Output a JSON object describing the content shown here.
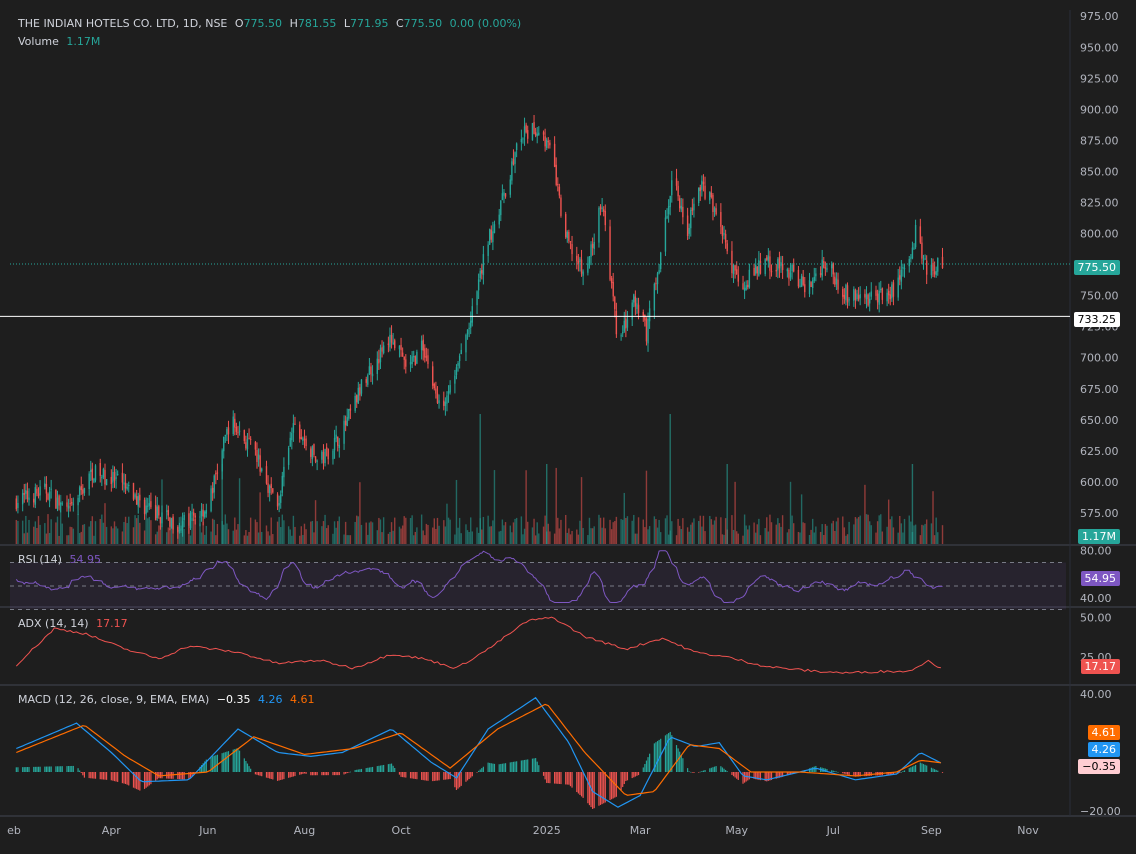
{
  "header": {
    "symbol": "THE INDIAN HOTELS CO. LTD, 1D, NSE",
    "o_label": "O",
    "o": "775.50",
    "h_label": "H",
    "h": "781.55",
    "l_label": "L",
    "l": "771.95",
    "c_label": "C",
    "c": "775.50",
    "change": "0.00 (0.00%)",
    "volume_label": "Volume",
    "volume": "1.17M"
  },
  "panes": {
    "rsi_label": "RSI (14)",
    "rsi_value": "54.95",
    "adx_label": "ADX (14, 14)",
    "adx_value": "17.17",
    "macd_label": "MACD (12, 26, close, 9, EMA, EMA)",
    "macd_hist": "−0.35",
    "macd_line": "4.26",
    "macd_signal": "4.61"
  },
  "badges": {
    "last_price": "775.50",
    "ref_price": "733.25",
    "volume": "1.17M",
    "rsi": "54.95",
    "adx": "17.17",
    "macd_signal": "4.61",
    "macd_line": "4.26",
    "macd_hist": "−0.35"
  },
  "colors": {
    "up": "#26a69a",
    "down": "#ef5350",
    "rsi": "#7e57c2",
    "adx": "#ef5350",
    "macd": "#2196f3",
    "signal": "#ff6d00",
    "bg": "#1e1e1e"
  },
  "chart_data": [
    {
      "type": "candlestick",
      "title": "THE INDIAN HOTELS CO. LTD, 1D, NSE",
      "x_ticks": [
        "eb",
        "Apr",
        "Jun",
        "Aug",
        "Oct",
        "2025",
        "Mar",
        "May",
        "Jul",
        "Sep",
        "Nov"
      ],
      "y_ticks": [
        "975.00",
        "950.00",
        "925.00",
        "900.00",
        "875.00",
        "850.00",
        "825.00",
        "800.00",
        "775.00",
        "750.00",
        "725.00",
        "700.00",
        "675.00",
        "650.00",
        "625.00",
        "600.00",
        "575.00"
      ],
      "ylim": [
        550,
        980
      ],
      "last_price": 775.5,
      "horizontal_line": 733.25,
      "close_path": [
        [
          "2024-02-01",
          585
        ],
        [
          "2024-02-20",
          593
        ],
        [
          "2024-03-05",
          575
        ],
        [
          "2024-03-20",
          608
        ],
        [
          "2024-04-05",
          600
        ],
        [
          "2024-04-25",
          577
        ],
        [
          "2024-05-15",
          565
        ],
        [
          "2024-06-01",
          580
        ],
        [
          "2024-06-15",
          650
        ],
        [
          "2024-07-01",
          622
        ],
        [
          "2024-07-15",
          580
        ],
        [
          "2024-07-25",
          645
        ],
        [
          "2024-08-10",
          615
        ],
        [
          "2024-08-25",
          640
        ],
        [
          "2024-09-10",
          688
        ],
        [
          "2024-09-25",
          716
        ],
        [
          "2024-10-05",
          690
        ],
        [
          "2024-10-15",
          710
        ],
        [
          "2024-10-25",
          660
        ],
        [
          "2024-11-05",
          690
        ],
        [
          "2024-11-15",
          735
        ],
        [
          "2024-11-25",
          795
        ],
        [
          "2024-12-05",
          830
        ],
        [
          "2024-12-15",
          878
        ],
        [
          "2024-12-28",
          885
        ],
        [
          "2025-01-05",
          860
        ],
        [
          "2025-01-12",
          800
        ],
        [
          "2025-01-25",
          765
        ],
        [
          "2025-02-05",
          825
        ],
        [
          "2025-02-15",
          710
        ],
        [
          "2025-02-25",
          745
        ],
        [
          "2025-03-05",
          720
        ],
        [
          "2025-03-15",
          790
        ],
        [
          "2025-03-22",
          850
        ],
        [
          "2025-03-30",
          800
        ],
        [
          "2025-04-08",
          840
        ],
        [
          "2025-04-18",
          820
        ],
        [
          "2025-04-28",
          770
        ],
        [
          "2025-05-05",
          760
        ],
        [
          "2025-05-20",
          778
        ],
        [
          "2025-06-05",
          768
        ],
        [
          "2025-06-15",
          755
        ],
        [
          "2025-06-25",
          778
        ],
        [
          "2025-07-10",
          750
        ],
        [
          "2025-07-25",
          748
        ],
        [
          "2025-08-05",
          750
        ],
        [
          "2025-08-15",
          770
        ],
        [
          "2025-08-22",
          800
        ],
        [
          "2025-08-30",
          770
        ],
        [
          "2025-09-08",
          775.5
        ]
      ]
    },
    {
      "type": "bar",
      "name": "Volume",
      "last_value": "1.17M",
      "spikes": [
        [
          "2024-06-10",
          "high"
        ],
        [
          "2024-11-20",
          "very high"
        ],
        [
          "2025-01-01",
          "high"
        ],
        [
          "2025-03-20",
          "very high"
        ],
        [
          "2025-04-25",
          "high"
        ],
        [
          "2025-08-20",
          "high"
        ]
      ]
    },
    {
      "type": "line",
      "name": "RSI (14)",
      "y_ticks": [
        "80.00",
        "40.00"
      ],
      "ylim": [
        33,
        84
      ],
      "band": [
        30,
        70
      ],
      "last_value": 54.95
    },
    {
      "type": "line",
      "name": "ADX (14, 14)",
      "y_ticks": [
        "50.00",
        "25.00"
      ],
      "ylim": [
        8,
        56
      ],
      "path": [
        [
          "2024-02-01",
          20
        ],
        [
          "2024-02-25",
          43
        ],
        [
          "2024-03-15",
          40
        ],
        [
          "2024-04-10",
          30
        ],
        [
          "2024-05-01",
          24
        ],
        [
          "2024-05-20",
          32
        ],
        [
          "2024-06-20",
          28
        ],
        [
          "2024-07-15",
          21
        ],
        [
          "2024-08-10",
          23
        ],
        [
          "2024-09-01",
          18
        ],
        [
          "2024-09-25",
          27
        ],
        [
          "2024-10-15",
          24
        ],
        [
          "2024-11-05",
          18
        ],
        [
          "2024-11-25",
          30
        ],
        [
          "2024-12-20",
          48
        ],
        [
          "2025-01-05",
          50
        ],
        [
          "2025-01-25",
          38
        ],
        [
          "2025-02-20",
          30
        ],
        [
          "2025-03-15",
          37
        ],
        [
          "2025-04-05",
          28
        ],
        [
          "2025-04-25",
          25
        ],
        [
          "2025-05-20",
          19
        ],
        [
          "2025-06-20",
          16
        ],
        [
          "2025-07-10",
          15
        ],
        [
          "2025-08-01",
          16
        ],
        [
          "2025-08-18",
          16
        ],
        [
          "2025-08-30",
          23
        ],
        [
          "2025-09-08",
          17.17
        ]
      ]
    },
    {
      "type": "line",
      "name": "MACD (12, 26, close, 9, EMA, EMA)",
      "y_ticks": [
        "40.00",
        "−20.00"
      ],
      "ylim": [
        -22,
        44
      ],
      "macd_path": [
        [
          "2024-02-01",
          12
        ],
        [
          "2024-03-10",
          25
        ],
        [
          "2024-04-01",
          10
        ],
        [
          "2024-04-20",
          -5
        ],
        [
          "2024-05-20",
          -4
        ],
        [
          "2024-06-20",
          22
        ],
        [
          "2024-07-15",
          10
        ],
        [
          "2024-08-05",
          8
        ],
        [
          "2024-08-25",
          10
        ],
        [
          "2024-09-25",
          22
        ],
        [
          "2024-10-20",
          5
        ],
        [
          "2024-11-05",
          -3
        ],
        [
          "2024-11-25",
          22
        ],
        [
          "2024-12-25",
          38
        ],
        [
          "2025-01-15",
          15
        ],
        [
          "2025-01-30",
          -10
        ],
        [
          "2025-02-15",
          -18
        ],
        [
          "2025-03-01",
          -12
        ],
        [
          "2025-03-20",
          18
        ],
        [
          "2025-04-05",
          13
        ],
        [
          "2025-04-20",
          15
        ],
        [
          "2025-05-05",
          -2
        ],
        [
          "2025-05-20",
          -4
        ],
        [
          "2025-06-20",
          2
        ],
        [
          "2025-07-15",
          -4
        ],
        [
          "2025-08-10",
          -1
        ],
        [
          "2025-08-25",
          10
        ],
        [
          "2025-09-08",
          4.26
        ]
      ],
      "signal_path": [
        [
          "2024-02-01",
          10
        ],
        [
          "2024-03-15",
          24
        ],
        [
          "2024-04-10",
          8
        ],
        [
          "2024-05-01",
          -2
        ],
        [
          "2024-06-01",
          0
        ],
        [
          "2024-06-30",
          18
        ],
        [
          "2024-08-01",
          9
        ],
        [
          "2024-09-01",
          12
        ],
        [
          "2024-10-01",
          20
        ],
        [
          "2024-11-01",
          2
        ],
        [
          "2024-12-01",
          22
        ],
        [
          "2025-01-01",
          35
        ],
        [
          "2025-01-25",
          10
        ],
        [
          "2025-02-20",
          -12
        ],
        [
          "2025-03-10",
          -10
        ],
        [
          "2025-04-01",
          14
        ],
        [
          "2025-04-20",
          12
        ],
        [
          "2025-05-10",
          0
        ],
        [
          "2025-06-10",
          0
        ],
        [
          "2025-07-15",
          -2
        ],
        [
          "2025-08-10",
          0
        ],
        [
          "2025-08-25",
          6
        ],
        [
          "2025-09-08",
          4.61
        ]
      ],
      "last_values": {
        "macd": 4.26,
        "signal": 4.61,
        "histogram": -0.35
      }
    }
  ]
}
